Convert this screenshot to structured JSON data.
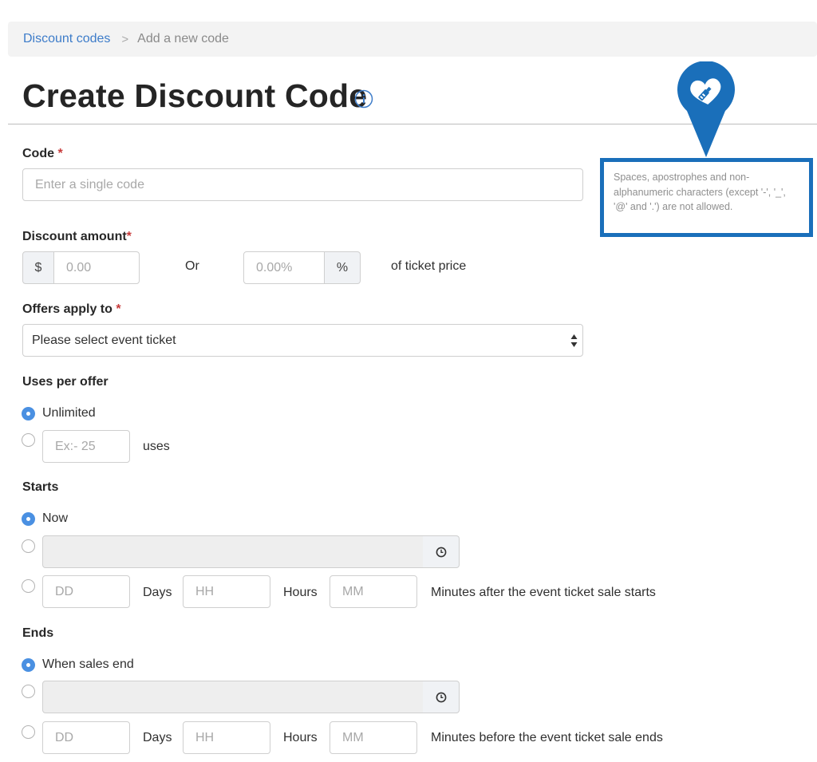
{
  "breadcrumb": {
    "parent": "Discount codes",
    "separator": ">",
    "current": "Add a new code"
  },
  "page": {
    "title": "Create Discount Code",
    "info_icon": "info-circle-icon"
  },
  "code": {
    "label": "Code",
    "required_mark": "*",
    "placeholder": "Enter a single code",
    "help_text": "Spaces, apostrophes and non-alphanumeric characters (except '-', '_', '@' and '.') are not allowed."
  },
  "discount": {
    "label": "Discount amount",
    "required_mark": "*",
    "currency_symbol": "$",
    "amount_placeholder": "0.00",
    "or_label": "Or",
    "percent_placeholder": "0.00%",
    "percent_symbol": "%",
    "suffix": "of ticket price"
  },
  "offers": {
    "label": "Offers apply to",
    "required_mark": "*",
    "selected": "Please select event ticket"
  },
  "uses": {
    "label": "Uses per offer",
    "unlimited_label": "Unlimited",
    "count_placeholder": "Ex:- 25",
    "count_suffix": "uses"
  },
  "starts": {
    "label": "Starts",
    "now_label": "Now",
    "dd_placeholder": "DD",
    "days_label": "Days",
    "hh_placeholder": "HH",
    "hours_label": "Hours",
    "mm_placeholder": "MM",
    "relative_suffix": "Minutes after the event ticket sale starts"
  },
  "ends": {
    "label": "Ends",
    "when_sales_end_label": "When sales end",
    "dd_placeholder": "DD",
    "days_label": "Days",
    "hh_placeholder": "HH",
    "hours_label": "Hours",
    "mm_placeholder": "MM",
    "relative_suffix": "Minutes before the event ticket sale ends"
  },
  "colors": {
    "link": "#3d7cc9",
    "required": "#c73a3a",
    "radio_selected": "#4a90e2",
    "callout": "#1a6fba"
  }
}
